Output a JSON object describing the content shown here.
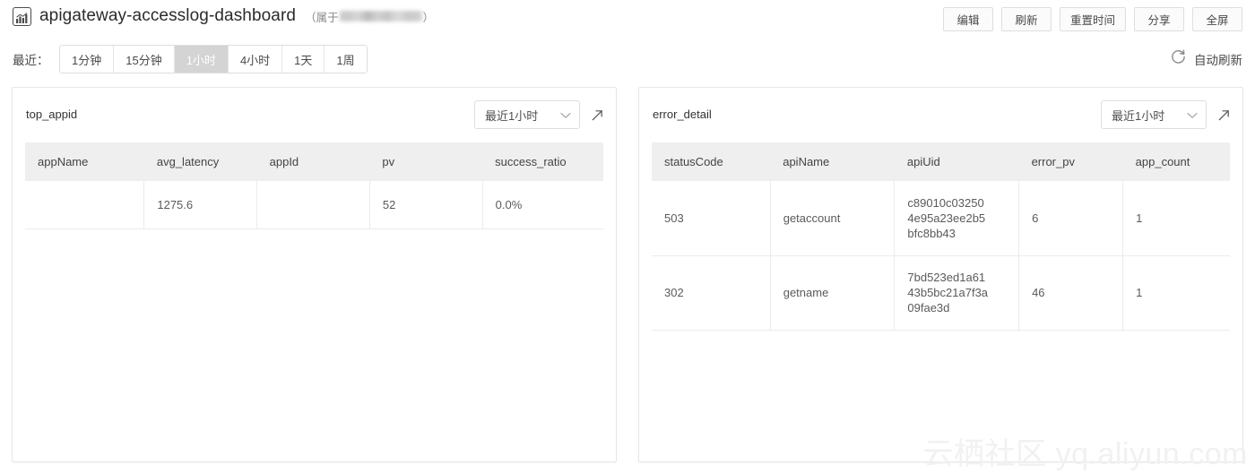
{
  "header": {
    "icon": "dashboard-chart-icon",
    "title": "apigateway-accesslog-dashboard",
    "owner_prefix": "（属于",
    "owner_suffix": "）",
    "owner_name_redacted": true,
    "actions": [
      {
        "label": "编辑",
        "name": "edit-button"
      },
      {
        "label": "刷新",
        "name": "refresh-button"
      },
      {
        "label": "重置时间",
        "name": "reset-time-button"
      },
      {
        "label": "分享",
        "name": "share-button"
      },
      {
        "label": "全屏",
        "name": "fullscreen-button"
      }
    ]
  },
  "toolbar": {
    "recent_label": "最近：",
    "ranges": [
      {
        "label": "1分钟",
        "active": false
      },
      {
        "label": "15分钟",
        "active": false
      },
      {
        "label": "1小时",
        "active": true
      },
      {
        "label": "4小时",
        "active": false
      },
      {
        "label": "1天",
        "active": false
      },
      {
        "label": "1周",
        "active": false
      }
    ],
    "auto_refresh_label": "自动刷新",
    "auto_refresh_icon": "refresh-circular-icon"
  },
  "panels": [
    {
      "id": "top_appid",
      "title": "top_appid",
      "range_value": "最近1小时",
      "expand_icon": "expand-arrow-icon",
      "chevron_icon": "chevron-down-icon",
      "columns": [
        "appName",
        "avg_latency",
        "appId",
        "pv",
        "success_ratio"
      ],
      "rows": [
        {
          "appName": "",
          "avg_latency": "1275.6",
          "appId": "",
          "pv": "52",
          "success_ratio": "0.0%"
        }
      ]
    },
    {
      "id": "error_detail",
      "title": "error_detail",
      "range_value": "最近1小时",
      "expand_icon": "expand-arrow-icon",
      "chevron_icon": "chevron-down-icon",
      "columns": [
        "statusCode",
        "apiName",
        "apiUid",
        "error_pv",
        "app_count"
      ],
      "rows": [
        {
          "statusCode": "503",
          "apiName": "getaccount",
          "apiUid": "c89010c032504e95a23ee2b5bfc8bb43",
          "error_pv": "6",
          "app_count": "1"
        },
        {
          "statusCode": "302",
          "apiName": "getname",
          "apiUid": "7bd523ed1a6143b5bc21a7f3a09fae3d",
          "error_pv": "46",
          "app_count": "1"
        }
      ]
    }
  ],
  "watermark": {
    "text": "云栖社区 yq.aliyun.com"
  },
  "colors": {
    "page_bg": "#ffffff",
    "panel_border": "#e6e6e6",
    "table_header_bg": "#efefef",
    "active_segment_bg": "#d4d4d4",
    "text_primary": "#333333",
    "text_secondary": "#5a5a5a",
    "watermark": "#f1f1f1"
  }
}
